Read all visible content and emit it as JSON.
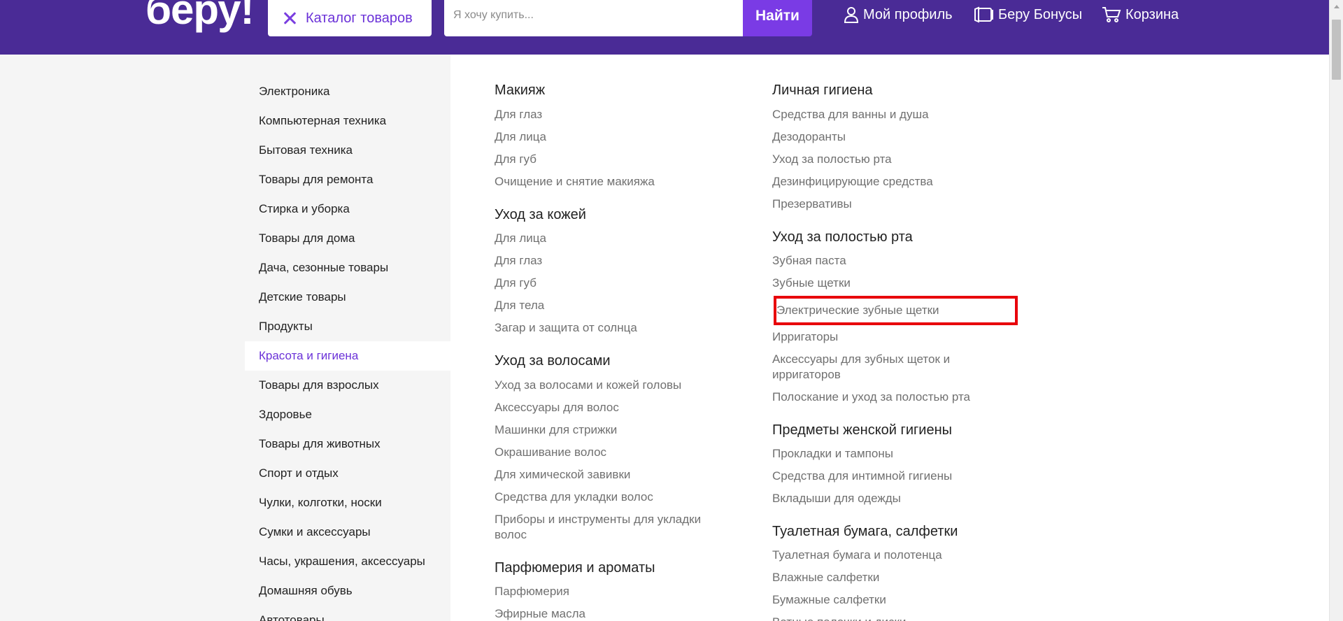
{
  "header": {
    "logo": "беру!",
    "catalog_label": "Каталог товаров",
    "search_placeholder": "Я хочу купить...",
    "search_button": "Найти",
    "profile_label": "Мой профиль",
    "bonus_label": "Беру Бонусы",
    "cart_label": "Корзина",
    "colors": {
      "brand": "#4a2b96",
      "accent": "#7a3be5",
      "highlight": "#e8000b"
    }
  },
  "sidebar": {
    "items": [
      {
        "label": "Электроника"
      },
      {
        "label": "Компьютерная техника"
      },
      {
        "label": "Бытовая техника"
      },
      {
        "label": "Товары для ремонта"
      },
      {
        "label": "Стирка и уборка"
      },
      {
        "label": "Товары для дома"
      },
      {
        "label": "Дача, сезонные товары"
      },
      {
        "label": "Детские товары"
      },
      {
        "label": "Продукты"
      },
      {
        "label": "Красота и гигиена",
        "active": true
      },
      {
        "label": "Товары для взрослых"
      },
      {
        "label": "Здоровье"
      },
      {
        "label": "Товары для животных"
      },
      {
        "label": "Спорт и отдых"
      },
      {
        "label": "Чулки, колготки, носки"
      },
      {
        "label": "Сумки и аксессуары"
      },
      {
        "label": "Часы, украшения, аксессуары"
      },
      {
        "label": "Домашняя обувь"
      },
      {
        "label": "Автотовары"
      }
    ]
  },
  "columns": [
    {
      "groups": [
        {
          "title": "Макияж",
          "links": [
            "Для глаз",
            "Для лица",
            "Для губ",
            "Очищение и снятие макияжа"
          ]
        },
        {
          "title": "Уход за кожей",
          "links": [
            "Для лица",
            "Для глаз",
            "Для губ",
            "Для тела",
            "Загар и защита от солнца"
          ]
        },
        {
          "title": "Уход за волосами",
          "links": [
            "Уход за волосами и кожей головы",
            "Аксессуары для волос",
            "Машинки для стрижки",
            "Окрашивание волос",
            "Для химической завивки",
            "Средства для укладки волос",
            "Приборы и инструменты для укладки волос"
          ]
        },
        {
          "title": "Парфюмерия и ароматы",
          "links": [
            "Парфюмерия",
            "Эфирные масла"
          ]
        }
      ]
    },
    {
      "groups": [
        {
          "title": "Личная гигиена",
          "links": [
            "Средства для ванны и душа",
            "Дезодоранты",
            "Уход за полостью рта",
            "Дезинфицирующие средства",
            "Презервативы"
          ]
        },
        {
          "title": "Уход за полостью рта",
          "links": [
            "Зубная паста",
            "Зубные щетки",
            "Электрические зубные щетки",
            "Ирригаторы",
            "Аксессуары для зубных щеток и ирригаторов",
            "Полоскание и уход за полостью рта"
          ]
        },
        {
          "title": "Предметы женской гигиены",
          "links": [
            "Прокладки и тампоны",
            "Средства для интимной гигиены",
            "Вкладыши для одежды"
          ]
        },
        {
          "title": "Туалетная бумага, салфетки",
          "links": [
            "Туалетная бумага и полотенца",
            "Влажные салфетки",
            "Бумажные салфетки",
            "Ватные палочки и диски"
          ]
        }
      ]
    }
  ]
}
